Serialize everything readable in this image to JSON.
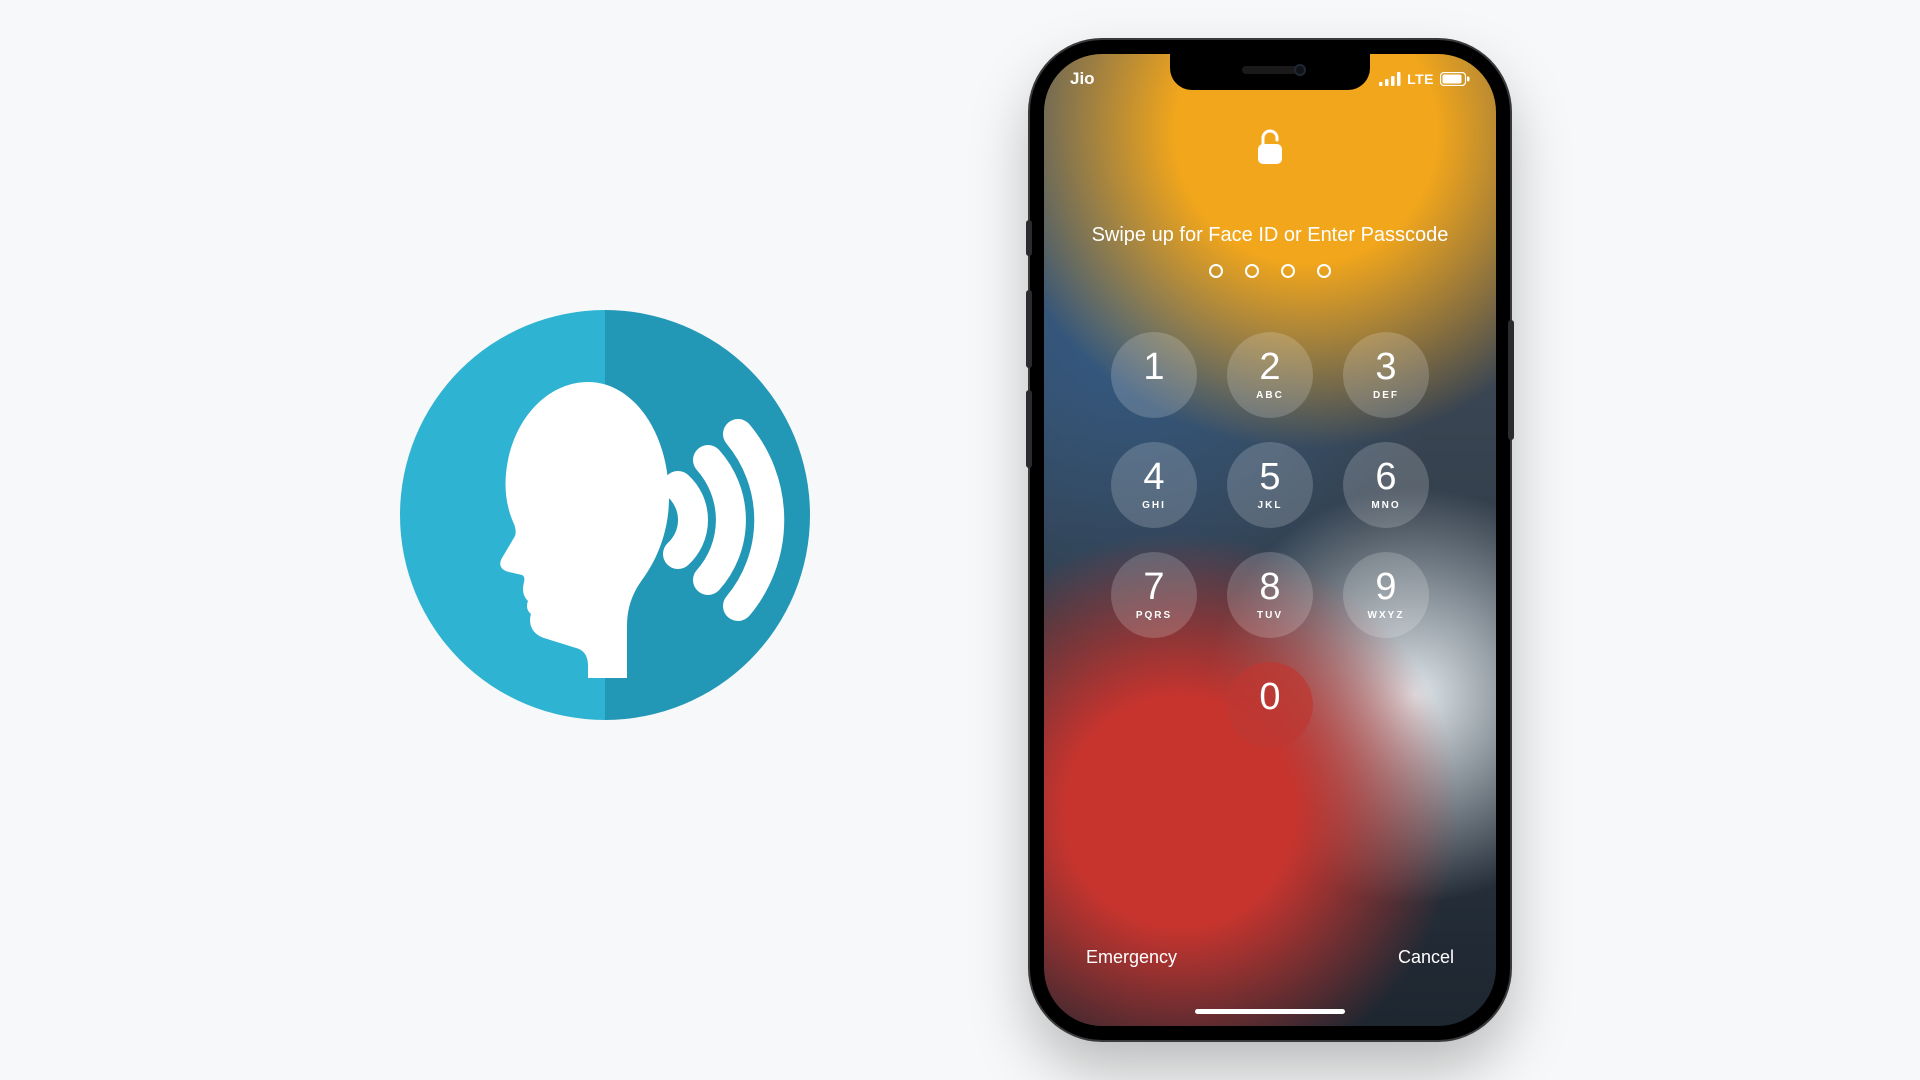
{
  "status_bar": {
    "carrier": "Jio",
    "network_label": "LTE"
  },
  "lock_screen": {
    "prompt": "Swipe up for Face ID or Enter Passcode",
    "passcode_length": 4,
    "emergency_label": "Emergency",
    "cancel_label": "Cancel"
  },
  "keypad": [
    {
      "digit": "1",
      "letters": ""
    },
    {
      "digit": "2",
      "letters": "ABC"
    },
    {
      "digit": "3",
      "letters": "DEF"
    },
    {
      "digit": "4",
      "letters": "GHI"
    },
    {
      "digit": "5",
      "letters": "JKL"
    },
    {
      "digit": "6",
      "letters": "MNO"
    },
    {
      "digit": "7",
      "letters": "PQRS"
    },
    {
      "digit": "8",
      "letters": "TUV"
    },
    {
      "digit": "9",
      "letters": "WXYZ"
    },
    {
      "digit": "0",
      "letters": ""
    }
  ],
  "icons": {
    "voice": "voice-speaking-icon",
    "lock": "unlock-icon",
    "signal": "cellular-signal-icon",
    "battery": "battery-icon",
    "home_indicator": "home-indicator"
  },
  "colors": {
    "page_bg": "#f6f8f9",
    "voice_left": "#2fb3d2",
    "voice_right": "#2297b6",
    "key_bg": "rgba(255,255,255,.18)",
    "zero_key_bg": "rgba(190,55,50,.72)",
    "text": "#ffffff"
  }
}
